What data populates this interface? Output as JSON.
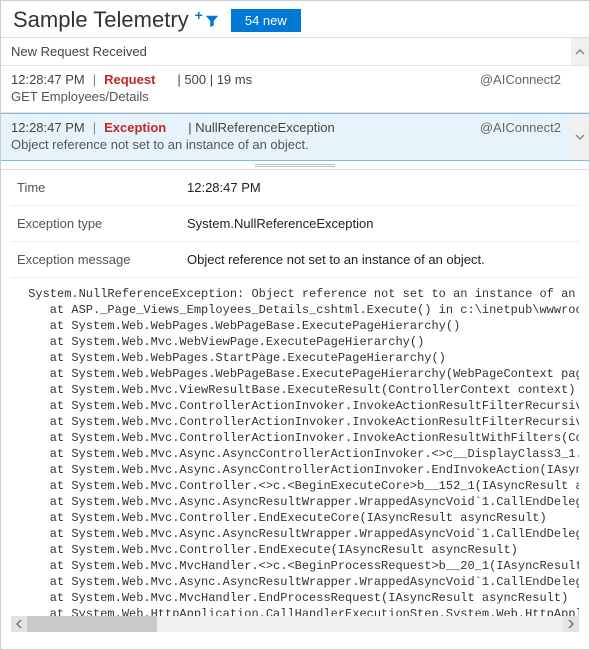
{
  "header": {
    "title": "Sample Telemetry",
    "new_badge": "54 new"
  },
  "list": {
    "heading": "New Request Received",
    "items": [
      {
        "time": "12:28:47 PM",
        "kind_label": "Request",
        "summary": "500 | 19 ms",
        "source": "@AIConnect2",
        "sub": "GET Employees/Details"
      },
      {
        "time": "12:28:47 PM",
        "kind_label": "Exception",
        "summary": "NullReferenceException",
        "source": "@AIConnect2",
        "sub": "Object reference not set to an instance of an object."
      }
    ]
  },
  "details": {
    "rows": [
      {
        "label": "Time",
        "value": "12:28:47 PM"
      },
      {
        "label": "Exception type",
        "value": "System.NullReferenceException"
      },
      {
        "label": "Exception message",
        "value": "Object reference not set to an instance of an object."
      }
    ],
    "stack": " System.NullReferenceException: Object reference not set to an instance of an object.\n    at ASP._Page_Views_Employees_Details_cshtml.Execute() in c:\\inetpub\\wwwroot\\Fabrikam\\Views\\Employees\\Details.cshtml\n    at System.Web.WebPages.WebPageBase.ExecutePageHierarchy()\n    at System.Web.Mvc.WebViewPage.ExecutePageHierarchy()\n    at System.Web.WebPages.StartPage.ExecutePageHierarchy()\n    at System.Web.WebPages.WebPageBase.ExecutePageHierarchy(WebPageContext pageContext)\n    at System.Web.Mvc.ViewResultBase.ExecuteResult(ControllerContext context)\n    at System.Web.Mvc.ControllerActionInvoker.InvokeActionResultFilterRecursive(IList`1 filters)\n    at System.Web.Mvc.ControllerActionInvoker.InvokeActionResultFilterRecursive(IList`1 filters)\n    at System.Web.Mvc.ControllerActionInvoker.InvokeActionResultWithFilters(ControllerContext)\n    at System.Web.Mvc.Async.AsyncControllerActionInvoker.<>c__DisplayClass3_1.<BeginInvokeAction>\n    at System.Web.Mvc.Async.AsyncControllerActionInvoker.EndInvokeAction(IAsyncResult)\n    at System.Web.Mvc.Controller.<>c.<BeginExecuteCore>b__152_1(IAsyncResult asyncResult)\n    at System.Web.Mvc.Async.AsyncResultWrapper.WrappedAsyncVoid`1.CallEndDelegate(IAsyncResult)\n    at System.Web.Mvc.Controller.EndExecuteCore(IAsyncResult asyncResult)\n    at System.Web.Mvc.Async.AsyncResultWrapper.WrappedAsyncVoid`1.CallEndDelegate(IAsyncResult)\n    at System.Web.Mvc.Controller.EndExecute(IAsyncResult asyncResult)\n    at System.Web.Mvc.MvcHandler.<>c.<BeginProcessRequest>b__20_1(IAsyncResult asyncResult)\n    at System.Web.Mvc.Async.AsyncResultWrapper.WrappedAsyncVoid`1.CallEndDelegate(IAsyncResult)\n    at System.Web.Mvc.MvcHandler.EndProcessRequest(IAsyncResult asyncResult)\n    at System.Web.HttpApplication.CallHandlerExecutionStep.System.Web.HttpApplication.IExecutionStep.Execute()\n    at System.Web.HttpApplication.ExecuteStep(IExecutionStep step, Boolean& completedSynchronously)"
  }
}
